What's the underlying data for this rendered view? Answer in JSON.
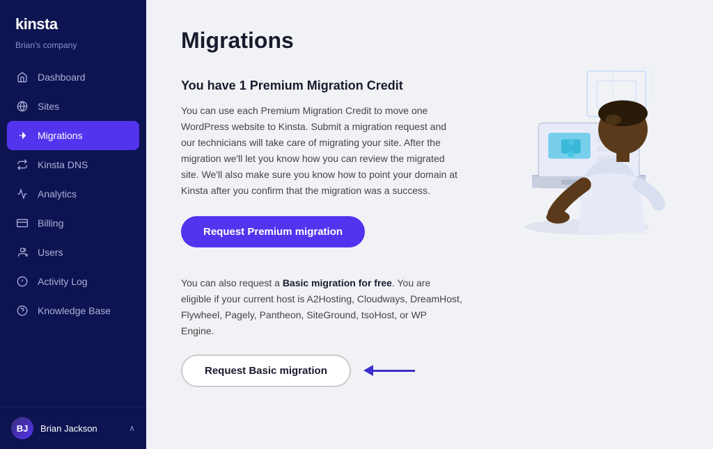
{
  "sidebar": {
    "logo": "kinsta",
    "company": "Brian's company",
    "nav_items": [
      {
        "id": "dashboard",
        "label": "Dashboard",
        "icon": "🏠",
        "active": false
      },
      {
        "id": "sites",
        "label": "Sites",
        "icon": "◎",
        "active": false
      },
      {
        "id": "migrations",
        "label": "Migrations",
        "icon": "➤",
        "active": true
      },
      {
        "id": "kinsta-dns",
        "label": "Kinsta DNS",
        "icon": "↻",
        "active": false
      },
      {
        "id": "analytics",
        "label": "Analytics",
        "icon": "📈",
        "active": false
      },
      {
        "id": "billing",
        "label": "Billing",
        "icon": "🪙",
        "active": false
      },
      {
        "id": "users",
        "label": "Users",
        "icon": "👤",
        "active": false
      },
      {
        "id": "activity-log",
        "label": "Activity Log",
        "icon": "👁",
        "active": false
      },
      {
        "id": "knowledge-base",
        "label": "Knowledge Base",
        "icon": "ℹ",
        "active": false
      }
    ],
    "user": {
      "name": "Brian Jackson",
      "initials": "BJ"
    }
  },
  "page": {
    "title": "Migrations",
    "premium_section": {
      "heading": "You have 1 Premium Migration Credit",
      "description": "You can use each Premium Migration Credit to move one WordPress website to Kinsta. Submit a migration request and our technicians will take care of migrating your site. After the migration we'll let you know how you can review the migrated site. We'll also make sure you know how to point your domain at Kinsta after you confirm that the migration was a success.",
      "button_label": "Request Premium migration"
    },
    "basic_section": {
      "description_prefix": "You can also request a ",
      "description_bold": "Basic migration for free",
      "description_suffix": ". You are eligible if your current host is A2Hosting, Cloudways, DreamHost, Flywheel, Pagely, Pantheon, SiteGround, tsoHost, or WP Engine.",
      "button_label": "Request Basic migration"
    }
  }
}
